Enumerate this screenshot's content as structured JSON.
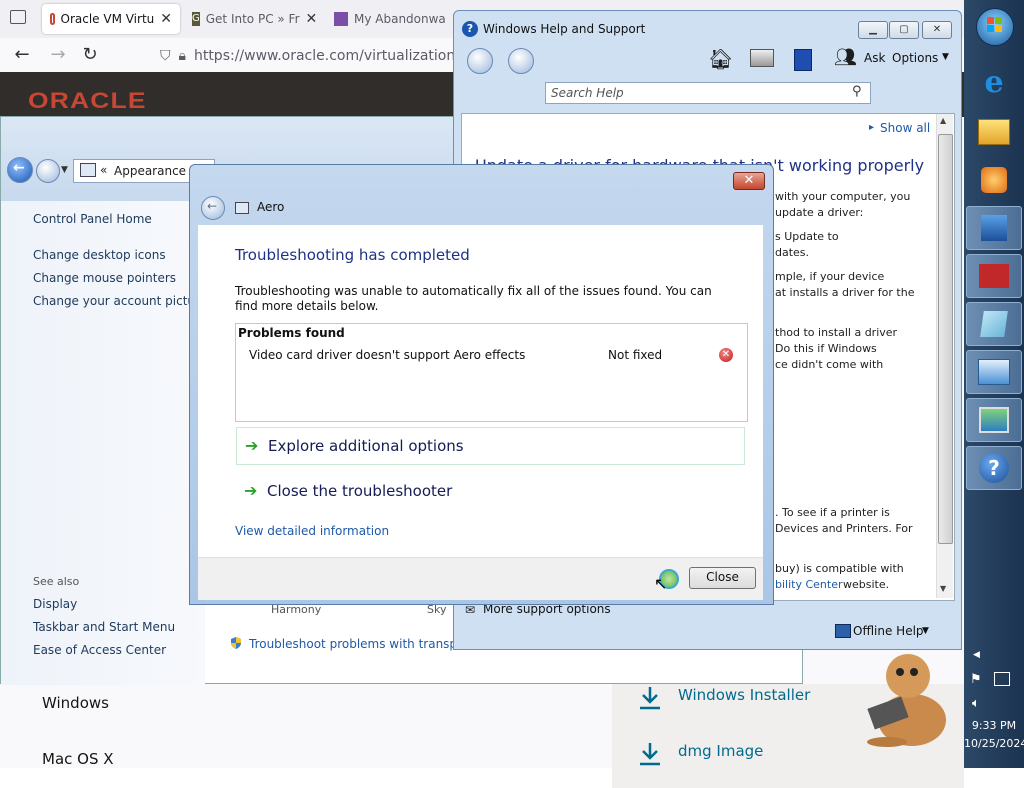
{
  "browser": {
    "tabs": [
      {
        "label": "Oracle VM Virtu",
        "active": true
      },
      {
        "label": "Get Into PC » Fr",
        "active": false
      },
      {
        "label": "My Abandonwa",
        "active": false
      }
    ],
    "url": "https://www.oracle.com/virtualization/te",
    "logo": "ORACLE",
    "downloads": [
      {
        "os": "Windows",
        "link": "Windows Installer"
      },
      {
        "os": "Mac OS X",
        "link": "dmg Image"
      }
    ]
  },
  "control_panel": {
    "breadcrumb": "Appearance ar",
    "links": [
      "Control Panel Home",
      "Change desktop icons",
      "Change mouse pointers",
      "Change your account picture"
    ],
    "see_also_label": "See also",
    "see_also": [
      "Display",
      "Taskbar and Start Menu",
      "Ease of Access Center"
    ],
    "themes": [
      "Harmony",
      "Sky"
    ],
    "troubleshoot_link": "Troubleshoot problems with transpare"
  },
  "help_window": {
    "title": "Windows Help and Support",
    "toolbar": {
      "ask": "Ask",
      "options": "Options"
    },
    "search_placeholder": "Search Help",
    "show_all": "Show all",
    "article_title": "Update a driver for hardware that isn't working properly",
    "lines": [
      "with your computer, you",
      "update a driver:",
      "s Update to",
      "dates.",
      "mple, if your device",
      "at installs a driver for the",
      "thod to install a driver",
      "Do this if Windows",
      "ce didn't come with",
      ". To see if a printer is",
      "Devices and Printers. For",
      "buy) is compatible with",
      "bility Center",
      " website."
    ],
    "more_support": "More support options",
    "offline_help": "Offline Help"
  },
  "dialog": {
    "title": "Aero",
    "heading": "Troubleshooting has completed",
    "description": "Troubleshooting was unable to automatically fix all of the issues found. You can find more details below.",
    "problems_header": "Problems found",
    "problem": {
      "name": "Video card driver doesn't support Aero effects",
      "status": "Not fixed"
    },
    "options": [
      "Explore additional options",
      "Close the troubleshooter"
    ],
    "details_link": "View detailed information",
    "close_button": "Close"
  },
  "taskbar": {
    "time": "9:33 PM",
    "date": "10/25/2024",
    "icons": [
      "start-orb-icon",
      "internet-explorer-icon",
      "file-explorer-icon",
      "media-player-icon",
      "app-icon",
      "app-icon-red",
      "notepad-icon",
      "control-panel-icon",
      "display-icon",
      "help-icon"
    ]
  }
}
